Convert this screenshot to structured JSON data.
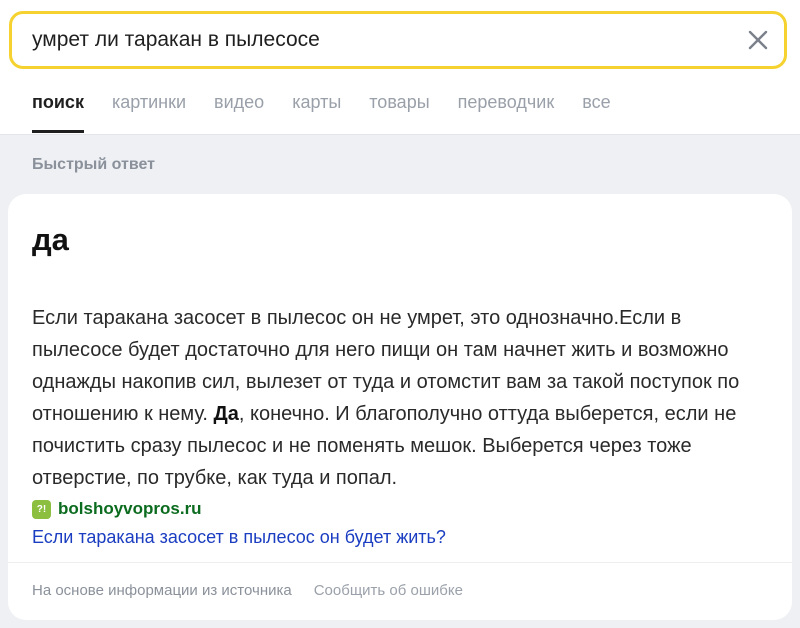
{
  "search": {
    "query": "умрет ли таракан в пылесосе",
    "clear_icon": "close-icon"
  },
  "tabs": [
    {
      "label": "поиск",
      "active": true
    },
    {
      "label": "картинки",
      "active": false
    },
    {
      "label": "видео",
      "active": false
    },
    {
      "label": "карты",
      "active": false
    },
    {
      "label": "товары",
      "active": false
    },
    {
      "label": "переводчик",
      "active": false
    },
    {
      "label": "все",
      "active": false
    }
  ],
  "quick_answer": {
    "section_label": "Быстрый ответ",
    "title": "да",
    "text_before": "Если таракана засосет в пылесос он не умрет, это однозначно.Если в пылесосе будет достаточно для него пищи он там начнет жить и возможно однажды накопив сил, вылезет от туда и отомстит вам за такой поступок по отношению к нему. ",
    "text_bold": "Да",
    "text_after": ", конечно. И благополучно оттуда выберется, если не почистить сразу пылесос и не поменять мешок. Выберется через тоже отверстие, по трубке, как туда и попал.",
    "source": {
      "favicon_text": "?!",
      "domain": "bolshoyvopros.ru",
      "link": "Если таракана засосет в пылесос он будет жить?"
    },
    "footer": {
      "based_on": "На основе информации из источника",
      "report": "Сообщить об ошибке"
    }
  },
  "colors": {
    "search_border": "#f5d22f",
    "link": "#1a3dc1",
    "source_domain": "#0b6b1e",
    "favicon": "#8cbf3f"
  }
}
